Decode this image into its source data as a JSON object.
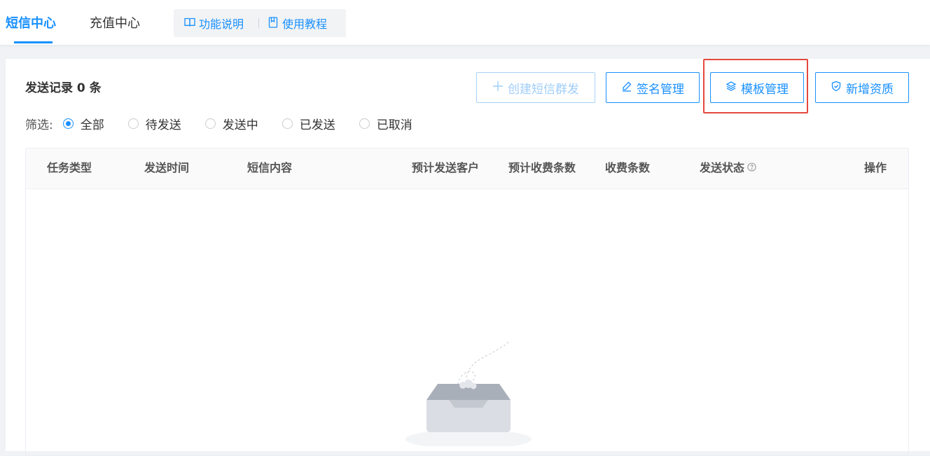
{
  "tabs": [
    {
      "label": "短信中心",
      "active": true
    },
    {
      "label": "充值中心",
      "active": false
    }
  ],
  "help": {
    "feature_label": "功能说明",
    "feature_icon": "book-open-icon",
    "tutorial_label": "使用教程",
    "tutorial_icon": "guide-doc-icon"
  },
  "record_summary": "发送记录 0 条",
  "buttons": {
    "create_group": "创建短信群发",
    "signature": "签名管理",
    "template": "模板管理",
    "qualification": "新增资质"
  },
  "filter": {
    "label": "筛选:",
    "options": [
      "全部",
      "待发送",
      "发送中",
      "已发送",
      "已取消"
    ],
    "selected": "全部"
  },
  "table": {
    "columns": [
      "任务类型",
      "发送时间",
      "短信内容",
      "预计发送客户",
      "预计收费条数",
      "收费条数",
      "发送状态",
      "操作"
    ],
    "rows": []
  },
  "colors": {
    "primary": "#1890ff",
    "highlight_border": "#e5483d"
  }
}
